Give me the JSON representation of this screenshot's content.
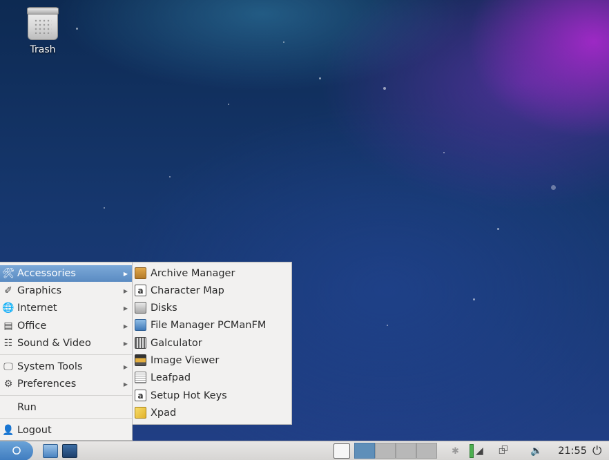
{
  "desktop": {
    "trash_label": "Trash"
  },
  "menu": {
    "items": [
      {
        "label": "Accessories",
        "icon": "accessories-icon",
        "has_submenu": true,
        "active": true
      },
      {
        "label": "Graphics",
        "icon": "graphics-icon",
        "has_submenu": true
      },
      {
        "label": "Internet",
        "icon": "globe-icon",
        "has_submenu": true
      },
      {
        "label": "Office",
        "icon": "office-icon",
        "has_submenu": true
      },
      {
        "label": "Sound & Video",
        "icon": "film-icon",
        "has_submenu": true
      },
      {
        "label": "System Tools",
        "icon": "monitor-icon",
        "has_submenu": true
      },
      {
        "label": "Preferences",
        "icon": "gear-icon",
        "has_submenu": true
      },
      {
        "label": "Run"
      },
      {
        "label": "Logout",
        "icon": "logout-icon"
      }
    ]
  },
  "submenu": {
    "items": [
      {
        "label": "Archive Manager",
        "icon": "archive-icon"
      },
      {
        "label": "Character Map",
        "icon": "character-map-icon"
      },
      {
        "label": "Disks",
        "icon": "disks-icon"
      },
      {
        "label": "File Manager PCManFM",
        "icon": "file-manager-icon"
      },
      {
        "label": "Galculator",
        "icon": "calculator-icon"
      },
      {
        "label": "Image Viewer",
        "icon": "image-viewer-icon"
      },
      {
        "label": "Leafpad",
        "icon": "text-editor-icon"
      },
      {
        "label": "Setup Hot Keys",
        "icon": "hotkeys-icon"
      },
      {
        "label": "Xpad",
        "icon": "notepad-icon"
      }
    ]
  },
  "taskbar": {
    "clock": "21:55",
    "active_workspace": 1,
    "colors": {
      "accent": "#5a8bc2",
      "panel": "#dcdbd9"
    }
  }
}
